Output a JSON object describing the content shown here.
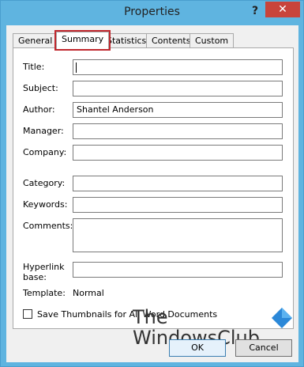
{
  "window": {
    "title": "Properties",
    "help_label": "?",
    "close_label": "✕"
  },
  "tabs": [
    {
      "label": "General"
    },
    {
      "label": "Summary"
    },
    {
      "label": "Statistics"
    },
    {
      "label": "Contents"
    },
    {
      "label": "Custom"
    }
  ],
  "fields": {
    "title": {
      "label": "Title:",
      "value": ""
    },
    "subject": {
      "label": "Subject:",
      "value": ""
    },
    "author": {
      "label": "Author:",
      "value": "Shantel Anderson"
    },
    "manager": {
      "label": "Manager:",
      "value": ""
    },
    "company": {
      "label": "Company:",
      "value": ""
    },
    "category": {
      "label": "Category:",
      "value": ""
    },
    "keywords": {
      "label": "Keywords:",
      "value": ""
    },
    "comments": {
      "label": "Comments:",
      "value": ""
    },
    "hyperlink_base": {
      "label_line1": "Hyperlink",
      "label_line2": "base:",
      "value": ""
    },
    "template": {
      "label": "Template:",
      "value": "Normal"
    }
  },
  "save_thumbnails": {
    "label": "Save Thumbnails for All Word Documents",
    "checked": false
  },
  "watermark": {
    "line1": "The",
    "line2": "WindowsClub"
  },
  "buttons": {
    "ok": "OK",
    "cancel": "Cancel"
  },
  "colors": {
    "titlebar": "#5fb4e0",
    "close": "#c8443b",
    "highlight": "#c0282e"
  }
}
